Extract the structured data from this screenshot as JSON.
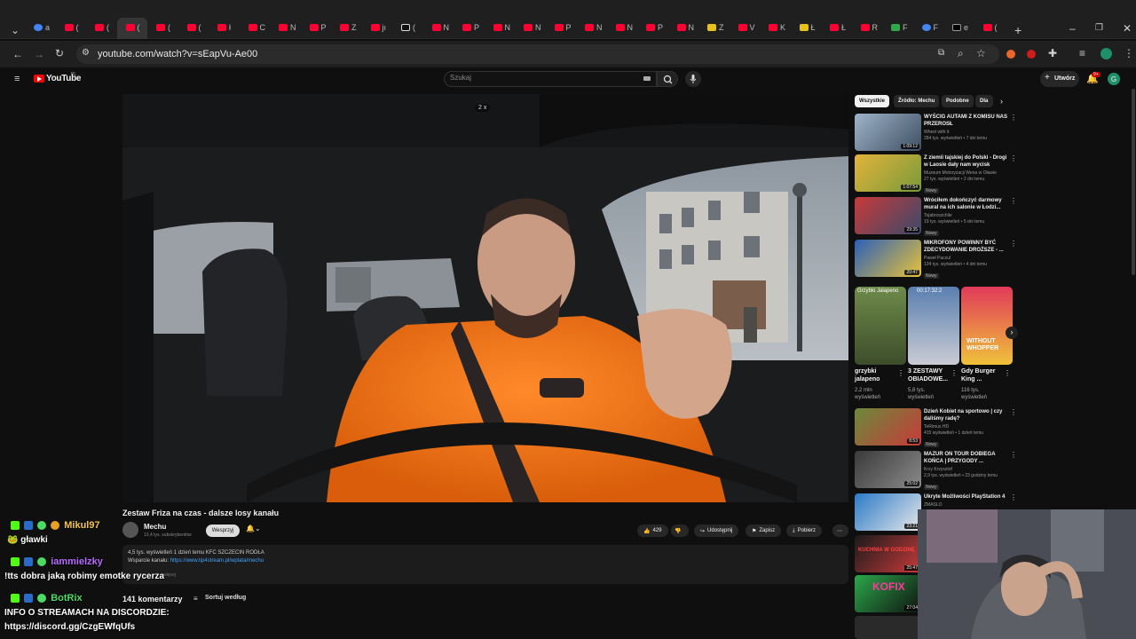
{
  "browser": {
    "url": "youtube.com/watch?v=sEapVu-Ae00",
    "tab_letters": [
      "a",
      "(",
      "(",
      "(",
      "(",
      "(",
      "ł",
      "C",
      "N",
      "P",
      "Z",
      "jı",
      "(",
      "N",
      "P",
      "N",
      "N",
      "P",
      "N",
      "N",
      "P",
      "N",
      "Z",
      "V",
      "K",
      "Ł",
      "Ł",
      "R",
      "F",
      "F",
      "e",
      "("
    ]
  },
  "youtube": {
    "logo": "YouTube",
    "logo_country": "PL",
    "search_placeholder": "Szukaj",
    "create_label": "Utwórz",
    "notif_count": "9+",
    "avatar_letter": "G"
  },
  "video": {
    "speed": "2 x",
    "title": "Zestaw Friza na czas - dalsze losy kanału",
    "channel": "Mechu",
    "subscribers": "13,4 tys. subskrybentów",
    "support_label": "Wesprzyj",
    "likes": "429",
    "share_label": "Udostępnij",
    "save_label": "Zapisz",
    "download_label": "Pobierz",
    "desc_meta": "4,5 tys. wyświetleń  1 dzień temu  KFC SZCZECIN RODŁA",
    "desc_support_label": "Wsparcie kanału:",
    "desc_support_link": "https://www.tip4stream.pl/wplata/mechu",
    "desc_more": "...więcej",
    "comments_count": "141 komentarzy",
    "sort_label": "Sortuj według"
  },
  "sidebar": {
    "chips": [
      "Wszystkie",
      "Źródło: Mechu",
      "Podobne",
      "Dla"
    ],
    "recs": [
      {
        "title": "WYŚCIG AUTAMI Z KOMISU NAS PRZEROSŁ",
        "channel": "Wheel with it",
        "meta": "284 tys. wyświetleń • 7 dni temu",
        "duration": "1:09:12",
        "new": ""
      },
      {
        "title": "Z ziemii tajskiej do Polski - Drogi w Laosie dały nam wycisk",
        "channel": "Muzeum Motoryzacji Wena w Oławie",
        "meta": "27 tys. wyświetleń • 2 dni temu",
        "duration": "1:07:54",
        "new": "Nowy"
      },
      {
        "title": "Wróciłem dokończyć darmowy mural na ich salonie w Łodzi...",
        "channel": "Tojabroszchile",
        "meta": "19 tys. wyświetleń • 5 dni temu",
        "duration": "29:35",
        "new": "Nowy"
      },
      {
        "title": "MIKROFONY POWINNY BYĆ ZDECYDOWANIE DROŻSZE - ...",
        "channel": "Paweł Paczul",
        "meta": "134 tys. wyświetleń • 4 dni temu",
        "duration": "20:47",
        "new": "Nowy"
      },
      {
        "title": "Dzień Kobiet na sportowo | czy daliśmy radę?",
        "channel": "TeRimus HD",
        "meta": "415 wyświetleń • 1 dzień temu",
        "duration": "8:53",
        "new": "Nowy"
      },
      {
        "title": "MAZUR ON TOUR DOBIEGA KOŃCA | PRZYGODY ...",
        "channel": "Krzy Krzysztof",
        "meta": "2,9 tys. wyświetleń • 23 godziny temu",
        "duration": "25:02",
        "new": "Nowy"
      },
      {
        "title": "Ukryte Możliwości PlayStation 4",
        "channel": "ZMASLO",
        "meta": "",
        "duration": "23:21",
        "new": ""
      }
    ],
    "shorts": [
      {
        "title": "grzybki jalapeno",
        "views": "2,2 mln wyświetleń",
        "overlay": "Grzybki Jalapeno"
      },
      {
        "title": "3 ZESTAWY OBIADOWE...",
        "views": "5,8 tys. wyświetleń",
        "overlay": "00:17:32:2"
      },
      {
        "title": "Gdy Burger King ...",
        "views": "116 tys. wyświetleń",
        "overlay": "WITHOUT WHOPPER"
      }
    ],
    "extra_thumbs": [
      {
        "text": "KUCHNIA W GODZINĘ",
        "duration": "25:47"
      },
      {
        "text": "KOFIX",
        "duration": "27:04"
      }
    ]
  },
  "chat": [
    {
      "user": "Mikul97",
      "user_color": "#f5c542",
      "msg": "gławki"
    },
    {
      "user": "iammielzky",
      "user_color": "#b86bff",
      "msg": "!tts dobra jaką robimy emotke rycerza"
    },
    {
      "user": "BotRix",
      "user_color": "#4cd964",
      "msg": "INFO O STREAMACH NA DISCORDZIE:",
      "msg2": "https://discord.gg/CzgEWfqUfs"
    }
  ]
}
